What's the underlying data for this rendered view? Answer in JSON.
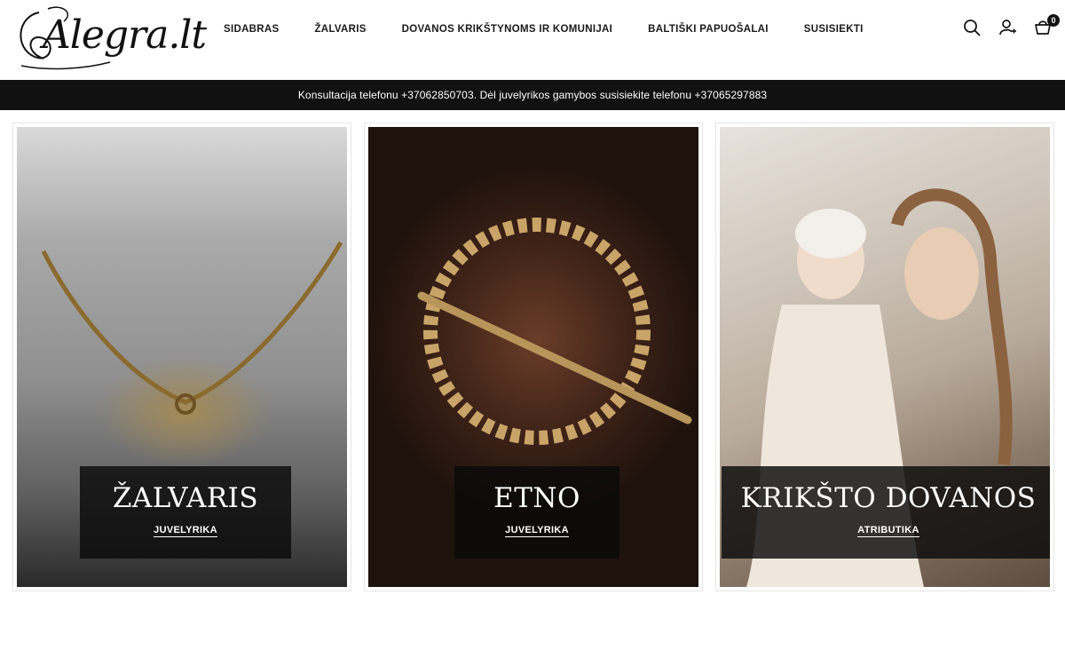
{
  "header": {
    "logo_text": "Alegra.lt",
    "nav": [
      {
        "label": "SIDABRAS"
      },
      {
        "label": "ŽALVARIS"
      },
      {
        "label": "DOVANOS KRIKŠTYNOMS IR KOMUNIJAI"
      },
      {
        "label": "BALTIŠKI PAPUOŠALAI"
      },
      {
        "label": "SUSISIEKTI"
      }
    ],
    "cart_count": "0",
    "icons": [
      "search-icon",
      "account-icon",
      "cart-icon"
    ]
  },
  "announcement": "Konsultacija telefonu +37062850703. Dėl juvelyrikos gamybos susisiekite telefonu +37065297883",
  "cards": [
    {
      "title": "ŽALVARIS",
      "subtitle": "JUVELYRIKA"
    },
    {
      "title": "ETNO",
      "subtitle": "JUVELYRIKA"
    },
    {
      "title": "KRIKŠTO DOVANOS",
      "subtitle": "ATRIBUTIKA"
    }
  ],
  "colors": {
    "bar": "#111111",
    "text": "#1a1a1a",
    "overlay": "#0a0a0a"
  }
}
